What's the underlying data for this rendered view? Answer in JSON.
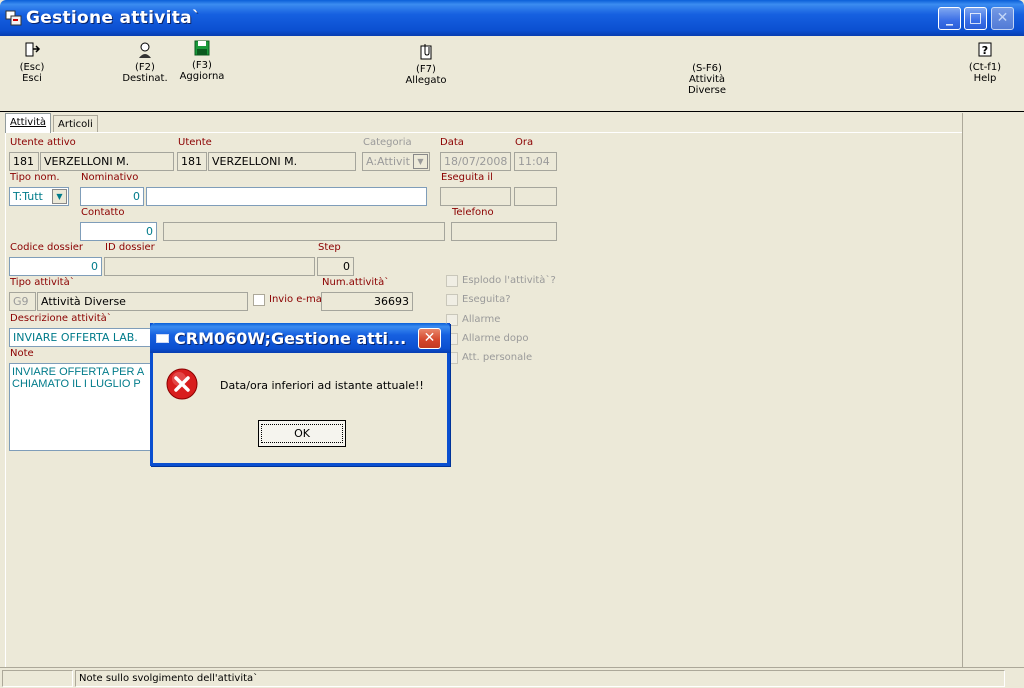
{
  "window": {
    "title": "Gestione attivita`",
    "controls": {
      "minimize": "_",
      "maximize": "□",
      "close": "✕"
    }
  },
  "toolbar": {
    "buttons": [
      {
        "key": "(Esc)",
        "label": "Esci",
        "icon": "exit-door-icon"
      },
      {
        "key": "(F2)",
        "label": "Destinat.",
        "icon": "recipient-person-icon"
      },
      {
        "key": "(F3)",
        "label": "Aggiorna",
        "icon": "save-disk-icon"
      },
      {
        "key": "(F7)",
        "label": "Allegato",
        "icon": "attachment-icon"
      },
      {
        "key": "(S-F6)",
        "label": "Attività",
        "label2": "Diverse",
        "icon": ""
      },
      {
        "key": "(Ct-f1)",
        "label": "Help",
        "icon": "help-icon"
      }
    ]
  },
  "tabs": [
    {
      "label": "Attività",
      "active": true
    },
    {
      "label": "Articoli",
      "active": false
    }
  ],
  "form": {
    "utente_attivo": {
      "label": "Utente attivo",
      "code": "181",
      "name": "VERZELLONI M."
    },
    "utente": {
      "label": "Utente",
      "code": "181",
      "name": "VERZELLONI M."
    },
    "categoria": {
      "label": "Categoria",
      "value": "A:Attivit"
    },
    "data": {
      "label": "Data",
      "value": "18/07/2008"
    },
    "ora": {
      "label": "Ora",
      "value": "11:04"
    },
    "tipo_nom": {
      "label": "Tipo nom.",
      "value": "T:Tutt"
    },
    "nominativo": {
      "label": "Nominativo",
      "code": "0",
      "name": ""
    },
    "eseguita_il": {
      "label": "Eseguita il",
      "date": "",
      "time": ""
    },
    "contatto": {
      "label": "Contatto",
      "code": "0",
      "name": ""
    },
    "telefono": {
      "label": "Telefono",
      "value": ""
    },
    "codice_dossier": {
      "label": "Codice dossier",
      "value": "0"
    },
    "id_dossier": {
      "label": "ID dossier",
      "value": ""
    },
    "step": {
      "label": "Step",
      "value": "0"
    },
    "tipo_attivita": {
      "label": "Tipo attività`",
      "code": "G9",
      "name": "Attività Diverse"
    },
    "invio_email": {
      "label": "Invio e-ma",
      "checked": false
    },
    "num_attivita": {
      "label": "Num.attività`",
      "value": "36693"
    },
    "descrizione": {
      "label": "Descrizione attività`",
      "value": "INVIARE OFFERTA LAB."
    },
    "note": {
      "label": "Note",
      "value": "INVIARE OFFERTA PER A\nCHIAMATO IL I LUGLIO P"
    },
    "checks": [
      {
        "label": "Esplodo l'attività`?",
        "checked": false
      },
      {
        "label": "Eseguita?",
        "checked": false
      },
      {
        "label": "Allarme",
        "checked": false
      },
      {
        "label": "Allarme dopo",
        "checked": false
      },
      {
        "label": "Att. personale",
        "checked": false
      }
    ]
  },
  "statusbar": {
    "text": "Note sullo svolgimento dell'attivita`"
  },
  "dialog": {
    "title": "CRM060W;Gestione atti...",
    "message": "Data/ora inferiori ad istante attuale!!",
    "ok_label": "OK",
    "close": "✕"
  },
  "colors": {
    "titlebar": "#0b4fd0",
    "label": "#8b0000",
    "accent_text": "#007b8a",
    "error": "#cc0000"
  }
}
